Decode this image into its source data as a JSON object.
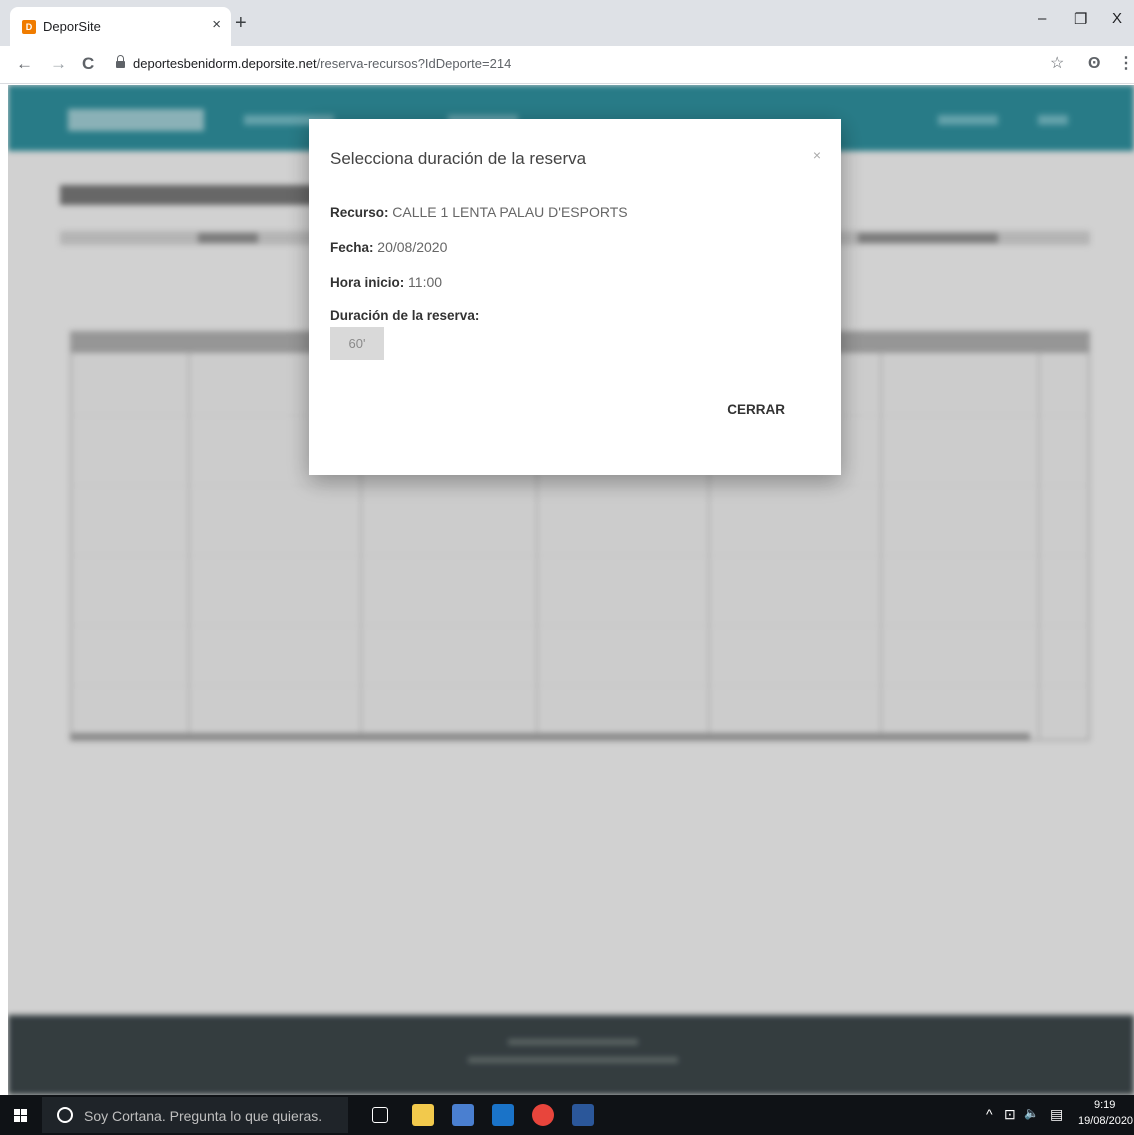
{
  "browser": {
    "tab_title": "DeporSite",
    "tab_favicon_letter": "D",
    "tab_close": "×",
    "new_tab": "+",
    "url_host": "deportesbenidorm.deporsite.net",
    "url_path": "/reserva-recursos?IdDeporte=214",
    "back": "←",
    "forward": "→",
    "reload": "C",
    "window_minimize": "–",
    "window_restore": "❐",
    "window_close": "X",
    "bookmark_star": "☆",
    "profile": "ʘ",
    "menu": "⋮"
  },
  "modal": {
    "title": "Selecciona duración de la reserva",
    "close": "×",
    "recurso_label": "Recurso:",
    "recurso_value": "CALLE 1 LENTA PALAU D'ESPORTS",
    "fecha_label": "Fecha:",
    "fecha_value": "20/08/2020",
    "hora_label": "Hora inicio:",
    "hora_value": "11:00",
    "duracion_label": "Duración de la reserva:",
    "duracion_option": "60'",
    "cerrar_button": "CERRAR"
  },
  "taskbar": {
    "search_placeholder": "Soy Cortana. Pregunta lo que quieras.",
    "tray_chevron": "^",
    "tray_network": "⊡",
    "tray_volume": "🔈",
    "tray_notifications": "▤",
    "clock_time": "9:19",
    "clock_date": "19/08/2020"
  },
  "colors": {
    "site_header": "#2d8a97",
    "site_footer": "#3a4447",
    "favicon": "#f07c00",
    "taskbar": "#0f1216"
  }
}
